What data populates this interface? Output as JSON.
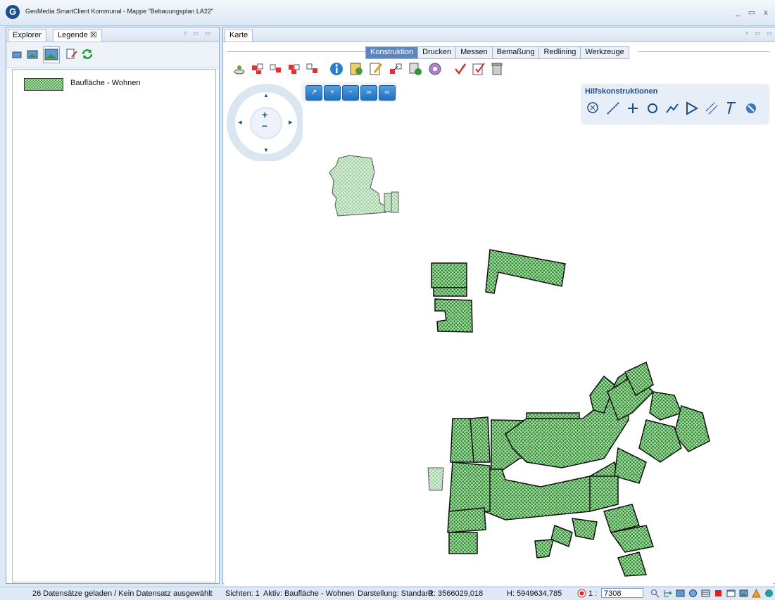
{
  "window": {
    "title": "GeoMedia SmartClient Kommunal - Mappe \"Bebauungsplan LA22\"",
    "logo_letter": "G",
    "min_glyph": "_",
    "max_glyph": "▭",
    "close_glyph": "x"
  },
  "left_panel": {
    "tabs": [
      {
        "label": "Explorer"
      },
      {
        "label": "Legende ☒"
      }
    ],
    "controls": "▿ ▭ ▭",
    "legend_items": [
      {
        "label": "Baufläche - Wohnen",
        "color": "#2e8b2e"
      }
    ]
  },
  "map_panel": {
    "tab_label": "Karte",
    "controls": "▿ ▭ ▭",
    "menu_tabs": [
      "Konstruktion",
      "Drucken",
      "Messen",
      "Bemaßung",
      "Redlining",
      "Werkzeuge"
    ],
    "active_menu": "Konstruktion",
    "hilfskonstruktionen_title": "Hilfskonstruktionen",
    "nav": {
      "up": "▲",
      "down": "▼",
      "left": "◂",
      "right": "▸",
      "plus": "+",
      "minus": "−"
    }
  },
  "status": {
    "left_text": "26 Datensätze geladen / Kein Datensatz ausgewählt",
    "views": "Sichten: 1",
    "active": "Aktiv: Baufläche - Wohnen",
    "display": "Darstellung: Standard",
    "r_coord": "R: 3566029,018",
    "h_coord": "H: 5949634,785",
    "scale_prefix": "1 :",
    "scale_value": "7308"
  }
}
